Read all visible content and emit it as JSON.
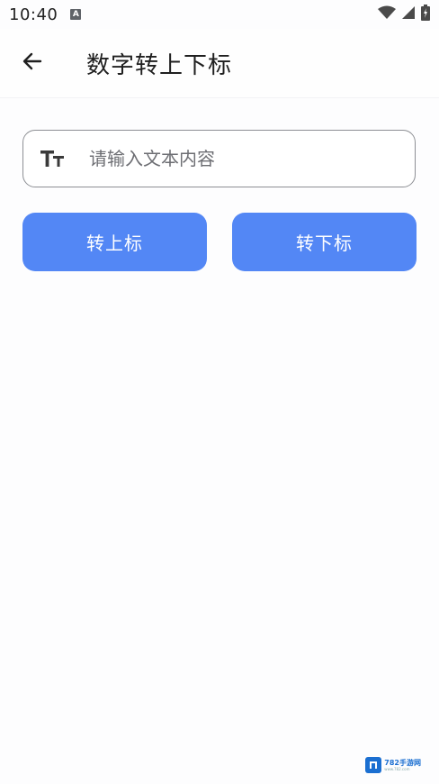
{
  "status_bar": {
    "time": "10:40",
    "notification_icon_letter": "A",
    "icons": [
      "wifi-icon",
      "signal-icon",
      "battery-icon"
    ]
  },
  "app_bar": {
    "back_icon": "arrow-left-icon",
    "title": "数字转上下标"
  },
  "input": {
    "icon": "text-size-icon",
    "value": "",
    "placeholder": "请输入文本内容"
  },
  "buttons": {
    "superscript_label": "转上标",
    "subscript_label": "转下标"
  },
  "watermark": {
    "text": "782手游网",
    "subtext": "www.782.com"
  },
  "colors": {
    "accent": "#5387f5",
    "background": "#fdfdfe",
    "input_border": "#8d8f94",
    "watermark": "#1b6fd1"
  }
}
